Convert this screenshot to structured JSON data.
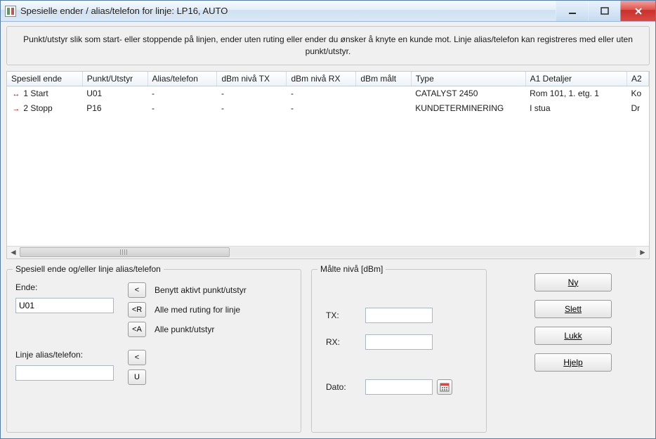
{
  "window": {
    "title": "Spesielle ender / alias/telefon for linje: LP16, AUTO"
  },
  "info_text": "Punkt/utstyr slik som start- eller stoppende på linjen, ender uten ruting eller ender du ønsker å knyte en kunde mot.  Linje alias/telefon kan registreres med eller uten punkt/utstyr.",
  "grid": {
    "columns": [
      "Spesiell ende",
      "Punkt/Utstyr",
      "Alias/telefon",
      "dBm nivå TX",
      "dBm nivå RX",
      "dBm målt",
      "Type",
      "A1 Detaljer",
      "A2"
    ],
    "rows": [
      {
        "icon": "↔",
        "ende": "1 Start",
        "punkt": "U01",
        "alias": "-",
        "tx": "-",
        "rx": "-",
        "malt": "",
        "type": "CATALYST 2450",
        "a1": "Rom 101, 1. etg. 1",
        "a2": "Ko"
      },
      {
        "icon": "→",
        "ende": "2 Stopp",
        "punkt": "P16",
        "alias": "-",
        "tx": "-",
        "rx": "-",
        "malt": "",
        "type": "KUNDETERMINERING",
        "a1": "I stua",
        "a2": "Dr"
      }
    ]
  },
  "panel_left": {
    "legend": "Spesiell ende og/eller linje alias/telefon",
    "ende_label": "Ende:",
    "ende_value": "U01",
    "btn_lt": "<",
    "btn_ltR": "<R",
    "btn_ltA": "<A",
    "helper_lt": "Benytt aktivt punkt/utstyr",
    "helper_ltR": "Alle med ruting for linje",
    "helper_ltA": "Alle punkt/utstyr",
    "alias_label": "Linje alias/telefon:",
    "alias_value": "",
    "btn_alias_lt": "<",
    "btn_U": "U"
  },
  "panel_mid": {
    "legend": "Målte nivå [dBm]",
    "tx_label": "TX:",
    "tx_value": "",
    "rx_label": "RX:",
    "rx_value": "",
    "dato_label": "Dato:",
    "dato_value": ""
  },
  "buttons": {
    "ny": "Ny",
    "slett": "Slett",
    "lukk": "Lukk",
    "hjelp": "Hjelp"
  }
}
